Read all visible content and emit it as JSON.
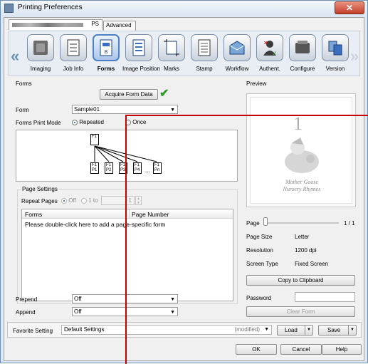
{
  "window": {
    "title": "Printing Preferences",
    "close": "✕"
  },
  "tabs": {
    "main": "PS",
    "advanced": "Advanced"
  },
  "nav": {
    "prev": "«",
    "next": "»",
    "items": [
      {
        "label": "Imaging",
        "icon": "imaging-icon"
      },
      {
        "label": "Job Info",
        "icon": "job-info-icon"
      },
      {
        "label": "Forms",
        "icon": "forms-icon"
      },
      {
        "label": "Image Position",
        "icon": "image-position-icon"
      },
      {
        "label": "Marks",
        "icon": "marks-icon"
      },
      {
        "label": "Stamp",
        "icon": "stamp-icon"
      },
      {
        "label": "Workflow",
        "icon": "workflow-icon"
      },
      {
        "label": "Authent.",
        "icon": "authentication-icon"
      },
      {
        "label": "Configure",
        "icon": "configure-icon"
      },
      {
        "label": "Version",
        "icon": "version-icon"
      }
    ]
  },
  "forms": {
    "group_label": "Forms",
    "acquire_button": "Acquire Form Data",
    "form_label": "Form",
    "form_value": "Sample01",
    "print_mode_label": "Forms Print Mode",
    "mode_repeated": "Repeated",
    "mode_once": "Once",
    "diagram": {
      "top": "F1",
      "pages": [
        [
          "F1",
          "P1"
        ],
        [
          "F1",
          "P2"
        ],
        [
          "F1",
          "P3"
        ],
        [
          "F1",
          "P4"
        ],
        [
          "F1",
          "Pn"
        ]
      ],
      "ellipsis": "..."
    }
  },
  "page_settings": {
    "group_label": "Page Settings",
    "repeat_label": "Repeat Pages",
    "off_label": "Off",
    "to_label": "1 to",
    "to_value": "1",
    "columns": [
      "Forms",
      "Page Number"
    ],
    "hint": "Please double-click here to add a page-specific form"
  },
  "prepend": {
    "label": "Prepend",
    "value": "Off"
  },
  "append": {
    "label": "Append",
    "value": "Off"
  },
  "preview": {
    "group_label": "Preview",
    "page_label": "Page",
    "page_count": "1 / 1",
    "image_number": "1",
    "image_caption_1": "Mother Goose",
    "image_caption_2": "Nursery Rhymes",
    "info": [
      {
        "key": "Page Size",
        "value": "Letter"
      },
      {
        "key": "Resolution",
        "value": "1200 dpi"
      },
      {
        "key": "Screen Type",
        "value": "Fixed Screen"
      }
    ],
    "copy_button": "Copy to Clipboard",
    "password_label": "Password",
    "clear_button": "Clear Form"
  },
  "favorite": {
    "label": "Favorite Setting",
    "value": "Default Settings",
    "modified": "(modified)",
    "load": "Load",
    "save": "Save"
  },
  "footer": {
    "ok": "OK",
    "cancel": "Cancel",
    "help": "Help"
  },
  "colors": {
    "accent": "#4d7fc9",
    "check": "#2e9a2e",
    "annotation_line": "#c80000"
  }
}
